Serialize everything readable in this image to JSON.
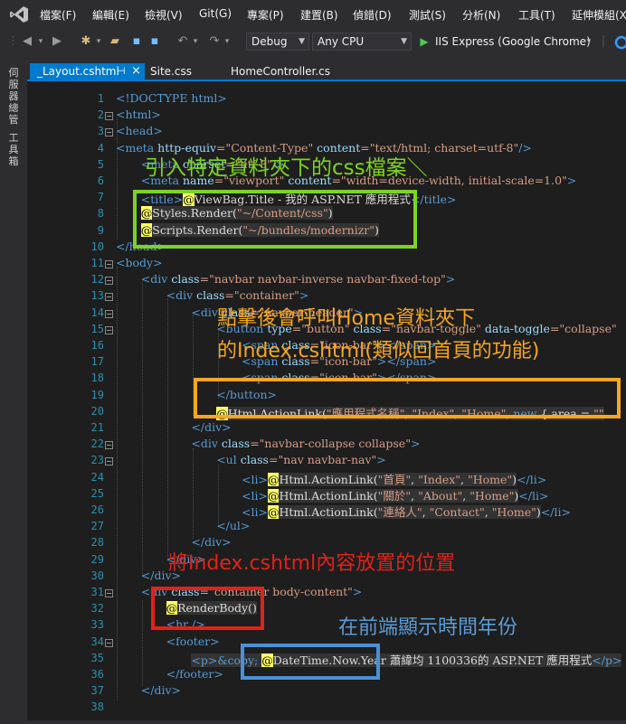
{
  "menubar": {
    "items": [
      "檔案(F)",
      "編輯(E)",
      "檢視(V)",
      "Git(G)",
      "專案(P)",
      "建置(B)",
      "偵錯(D)",
      "測試(S)",
      "分析(N)",
      "工具(T)",
      "延伸模組(X"
    ]
  },
  "toolbar": {
    "config": "Debug",
    "platform": "Any CPU",
    "run": "IIS Express (Google Chrome)"
  },
  "sidebar": {
    "tab1": "伺服器總管",
    "tab2": "工具箱"
  },
  "tabs": [
    {
      "label": "_Layout.cshtml"
    },
    {
      "label": "Site.css"
    },
    {
      "label": "HomeController.cs"
    }
  ],
  "tab_pin": "⊣",
  "tab_close": "×",
  "line_numbers": [
    "1",
    "2",
    "3",
    "4",
    "5",
    "6",
    "7",
    "8",
    "9",
    "10",
    "11",
    "12",
    "13",
    "14",
    "15",
    "16",
    "17",
    "18",
    "19",
    "20",
    "21",
    "22",
    "23",
    "24",
    "25",
    "26",
    "27",
    "28",
    "29",
    "30",
    "31",
    "32",
    "33",
    "34",
    "35",
    "36",
    "37",
    "38"
  ],
  "code": {
    "l1": [
      "<!DOCTYPE html>"
    ],
    "l2": [
      "<html>"
    ],
    "l3": [
      "<head>"
    ],
    "l4": [
      "<meta",
      " http-equiv",
      "=\"Content-Type\"",
      " content",
      "=\"text/html; charset=utf-8\"",
      "/>"
    ],
    "l5": [
      "<meta",
      " charset",
      "=\"utf-8\"",
      "/>"
    ],
    "l6": [
      "<meta",
      " name",
      "=\"viewport\"",
      " content",
      "=\"width=device-width, initial-scale=1.0\"",
      ">"
    ],
    "l7": [
      "<title>",
      "@",
      "ViewBag.Title",
      " - 我的 ASP.NET 應用程式",
      "</title>"
    ],
    "l8": [
      "@",
      "Styles.Render(",
      "\"~/Content/css\"",
      ")"
    ],
    "l9": [
      "@",
      "Scripts.Render(",
      "\"~/bundles/modernizr\"",
      ")"
    ],
    "l10": [
      "</head>"
    ],
    "l11": [
      "<body>"
    ],
    "l12": [
      "<div",
      " class",
      "=\"navbar navbar-inverse navbar-fixed-top\"",
      ">"
    ],
    "l13": [
      "<div",
      " class",
      "=\"container\"",
      ">"
    ],
    "l14": [
      "<div",
      " class",
      "=\"navbar-header\"",
      ">"
    ],
    "l15": [
      "<button",
      " type",
      "=\"button\"",
      " class",
      "=\"navbar-toggle\"",
      " data-toggle",
      "=\"collapse\""
    ],
    "l16": [
      "<span",
      " class",
      "=\"icon-bar\"",
      "></span>"
    ],
    "l17": [
      "<span",
      " class",
      "=\"icon-bar\"",
      "></span>"
    ],
    "l18": [
      "<span",
      " class",
      "=\"icon-bar\"",
      "></span>"
    ],
    "l19": [
      "</button>"
    ],
    "l20": [
      "@",
      "Html.ActionLink(",
      "\"應用程式名稱\"",
      ", ",
      "\"Index\"",
      ", ",
      "\"Home\"",
      ", ",
      "new",
      " { area = ",
      "\"\""
    ],
    "l21": [
      "</div>"
    ],
    "l22": [
      "<div",
      " class",
      "=\"navbar-collapse collapse\"",
      ">"
    ],
    "l23": [
      "<ul",
      " class",
      "=\"nav navbar-nav\"",
      ">"
    ],
    "l24": [
      "<li>",
      "@",
      "Html.ActionLink(",
      "\"首頁\"",
      ", ",
      "\"Index\"",
      ", ",
      "\"Home\"",
      ")",
      "</li>"
    ],
    "l25": [
      "<li>",
      "@",
      "Html.ActionLink(",
      "\"關於\"",
      ", ",
      "\"About\"",
      ", ",
      "\"Home\"",
      ")",
      "</li>"
    ],
    "l26": [
      "<li>",
      "@",
      "Html.ActionLink(",
      "\"連絡人\"",
      ", ",
      "\"Contact\"",
      ", ",
      "\"Home\"",
      ")",
      "</li>"
    ],
    "l27": [
      "</ul>"
    ],
    "l28": [
      "</div>"
    ],
    "l29": [
      "</div>"
    ],
    "l30": [
      "</div>"
    ],
    "l31": [
      "<div",
      " class",
      "=\"container body-content\"",
      ">"
    ],
    "l32": [
      "@",
      "RenderBody()"
    ],
    "l33": [
      "<hr />"
    ],
    "l34": [
      "<footer>"
    ],
    "l35": [
      "<p>",
      "&copy;",
      " ",
      "@",
      "DateTime.Now.Year",
      " 蕭緯均 1100336的 ASP.NET 應用程式",
      "</p>"
    ],
    "l36": [
      "</footer>"
    ],
    "l37": [
      "</div>"
    ]
  },
  "annotations": {
    "green": "引入特定資料夾下的css檔案＼",
    "orange1": "點擊後會呼叫Home資料夾下",
    "orange2": "的Index.cshtml(類似回首頁的功能)",
    "red": "將Index.cshtml內容放置的位置",
    "blue": "在前端顯示時間年份"
  },
  "colors": {
    "green": "#7ed321",
    "orange": "#f5a623",
    "red": "#e0221b",
    "blue": "#4a90d9",
    "blue_text": "#5b9bd5"
  }
}
